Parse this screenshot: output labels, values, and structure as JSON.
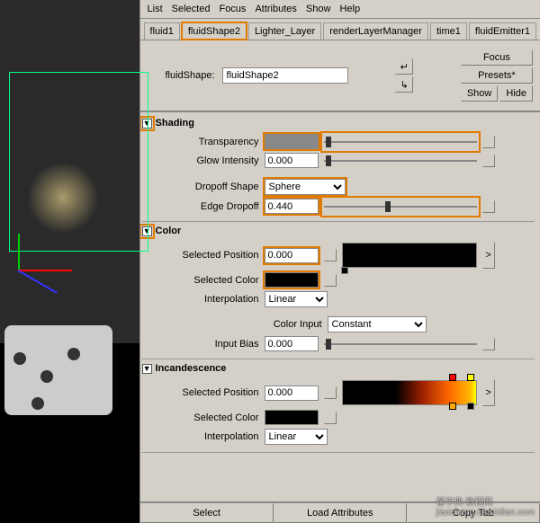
{
  "menu": {
    "list": "List",
    "selected": "Selected",
    "focus": "Focus",
    "attributes": "Attributes",
    "show": "Show",
    "help": "Help"
  },
  "tabs": {
    "fluid1": "fluid1",
    "fluidShape2": "fluidShape2",
    "lighter": "Lighter_Layer",
    "rlm": "renderLayerManager",
    "time1": "time1",
    "fluidEmitter1": "fluidEmitter1"
  },
  "header": {
    "label": "fluidShape:",
    "value": "fluidShape2",
    "focus": "Focus",
    "presets": "Presets*",
    "show": "Show",
    "hide": "Hide"
  },
  "shading": {
    "title": "Shading",
    "transparency": "Transparency",
    "glow_label": "Glow Intensity",
    "glow_value": "0.000",
    "dropoff_shape_label": "Dropoff Shape",
    "dropoff_shape_value": "Sphere",
    "edge_dropoff_label": "Edge Dropoff",
    "edge_dropoff_value": "0.440"
  },
  "color": {
    "title": "Color",
    "sel_pos_label": "Selected Position",
    "sel_pos_value": "0.000",
    "sel_color_label": "Selected Color",
    "interp_label": "Interpolation",
    "interp_value": "Linear",
    "color_input_label": "Color Input",
    "color_input_value": "Constant",
    "input_bias_label": "Input Bias",
    "input_bias_value": "0.000"
  },
  "incan": {
    "title": "Incandescence",
    "sel_pos_label": "Selected Position",
    "sel_pos_value": "0.000",
    "sel_color_label": "Selected Color",
    "interp_label": "Interpolation",
    "interp_value": "Linear"
  },
  "bottom": {
    "select": "Select",
    "load": "Load Attributes",
    "copy": "Copy Tab"
  },
  "icons": {
    "expand_open": "▼",
    "arrow_right": ">"
  }
}
